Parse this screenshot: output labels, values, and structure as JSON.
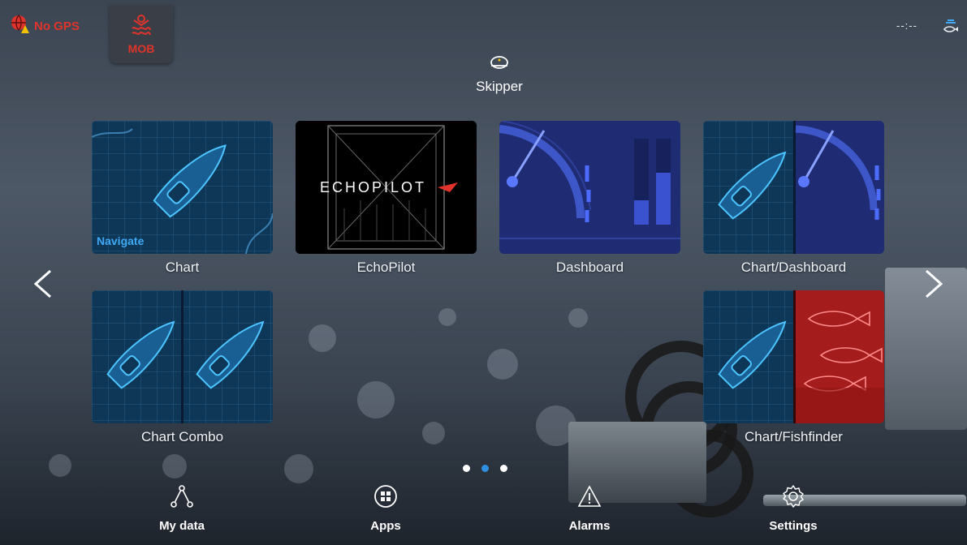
{
  "status": {
    "gps_label": "No GPS",
    "mob_label": "MOB",
    "clock": "--:--"
  },
  "profile": {
    "name": "Skipper"
  },
  "tiles": [
    {
      "label": "Chart",
      "tag": "Navigate"
    },
    {
      "label": "EchoPilot",
      "logo_text": "ECHOPILOT"
    },
    {
      "label": "Dashboard"
    },
    {
      "label": "Chart/Dashboard"
    },
    {
      "label": "Chart Combo"
    },
    {
      "label": "Chart/Fishfinder"
    }
  ],
  "bottom_nav": [
    {
      "label": "My data",
      "icon": "share-nodes-icon"
    },
    {
      "label": "Apps",
      "icon": "apps-grid-icon"
    },
    {
      "label": "Alarms",
      "icon": "warning-triangle-icon"
    },
    {
      "label": "Settings",
      "icon": "gear-icon"
    }
  ],
  "pager": {
    "pages": 3,
    "active": 2
  },
  "colors": {
    "alert_red": "#e0332b",
    "accent_blue": "#2f8fe0",
    "chart_tile_bg": "#0f3a5c"
  }
}
